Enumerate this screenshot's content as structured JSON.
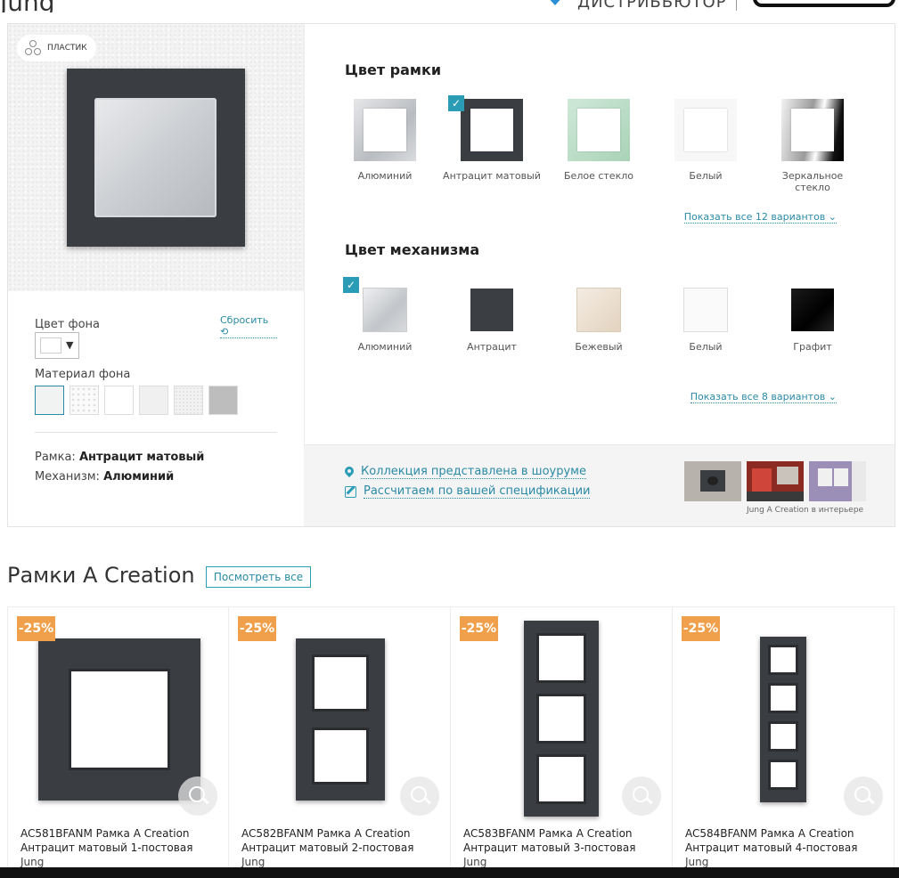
{
  "header": {
    "brand_partial": "Jung",
    "distributor_label": "ДИСТРИБЬЮТОР"
  },
  "preview": {
    "material_badge": "ПЛАСТИК"
  },
  "background": {
    "color_label": "Цвет фона",
    "reset_label": "Сбросить ⟲",
    "material_label": "Материал фона",
    "materials": [
      "white-plaster",
      "white-pattern",
      "white-smooth",
      "light-gray",
      "light-texture",
      "gray"
    ]
  },
  "summary": {
    "frame_label": "Рамка:",
    "frame_value": "Антрацит матовый",
    "mech_label": "Механизм:",
    "mech_value": "Алюминий"
  },
  "frame_color": {
    "title": "Цвет рамки",
    "items": [
      {
        "label": "Алюминий",
        "selected": false
      },
      {
        "label": "Антрацит матовый",
        "selected": true
      },
      {
        "label": "Белое стекло",
        "selected": false
      },
      {
        "label": "Белый",
        "selected": false
      },
      {
        "label": "Зеркальное стекло",
        "selected": false
      }
    ],
    "show_all": "Показать все 12 вариантов ⌄"
  },
  "mech_color": {
    "title": "Цвет механизма",
    "items": [
      {
        "label": "Алюминий",
        "selected": true
      },
      {
        "label": "Антрацит",
        "selected": false
      },
      {
        "label": "Бежевый",
        "selected": false
      },
      {
        "label": "Белый",
        "selected": false
      },
      {
        "label": "Графит",
        "selected": false
      }
    ],
    "show_all": "Показать все 8 вариантов ⌄"
  },
  "links": {
    "showroom": "Коллекция представлена в шоуруме",
    "spec": "Рассчитаем по вашей спецификации",
    "interior_caption": "Jung A Creation в интерьере"
  },
  "related": {
    "title": "Рамки A Creation",
    "see_all": "Посмотреть все",
    "products": [
      {
        "discount": "-25%",
        "name": "AC581BFANM Рамка A Creation Антрацит матовый 1-постовая",
        "brand": "Jung"
      },
      {
        "discount": "-25%",
        "name": "AC582BFANM Рамка A Creation Антрацит матовый 2-постовая",
        "brand": "Jung"
      },
      {
        "discount": "-25%",
        "name": "AC583BFANM Рамка A Creation Антрацит матовый 3-постовая",
        "brand": "Jung"
      },
      {
        "discount": "-25%",
        "name": "AC584BFANM Рамка A Creation Антрацит матовый 4-постовая",
        "brand": "Jung"
      }
    ]
  },
  "colors": {
    "accent": "#2a9cb6",
    "discount": "#f0a04b",
    "frame_anthracite": "#3a3d42"
  }
}
